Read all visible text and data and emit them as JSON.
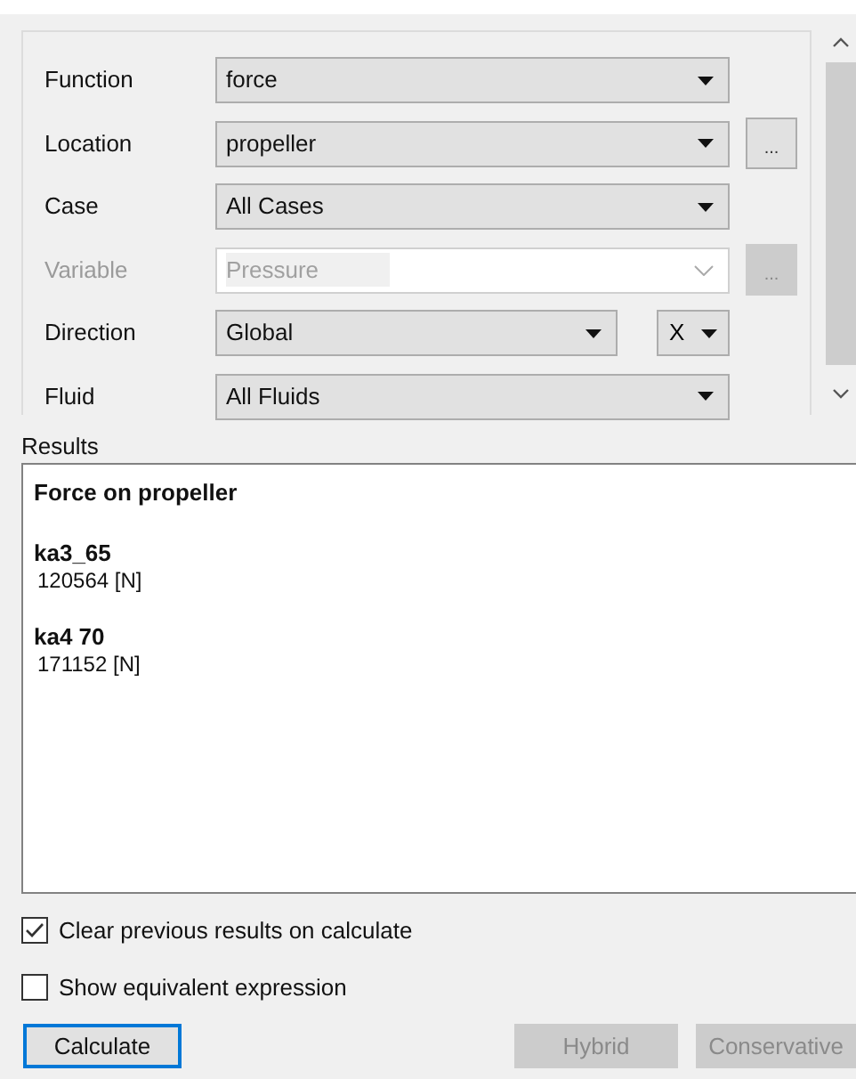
{
  "form": {
    "rows": [
      {
        "label": "Function",
        "value": "force",
        "disabled": false
      },
      {
        "label": "Location",
        "value": "propeller",
        "disabled": false,
        "browse": {
          "label": "...",
          "disabled": false
        }
      },
      {
        "label": "Case",
        "value": "All Cases",
        "disabled": false
      },
      {
        "label": "Variable",
        "value": "Pressure",
        "disabled": true,
        "browse": {
          "label": "...",
          "disabled": true
        }
      },
      {
        "label": "Direction",
        "value": "Global",
        "disabled": false,
        "axis": "X"
      },
      {
        "label": "Fluid",
        "value": "All Fluids",
        "disabled": false
      }
    ]
  },
  "results": {
    "label": "Results",
    "title": "Force on propeller",
    "entries": [
      {
        "name": "ka3_65",
        "value": "120564 [N]"
      },
      {
        "name": "ka4 70",
        "value": "171152 [N]"
      }
    ]
  },
  "options": [
    {
      "label": "Clear previous results on calculate",
      "checked": true
    },
    {
      "label": "Show equivalent expression",
      "checked": false
    }
  ],
  "buttons": [
    {
      "label": "Calculate",
      "disabled": false,
      "focused": true
    },
    {
      "label": "Hybrid",
      "disabled": true,
      "focused": false
    },
    {
      "label": "Conservative",
      "disabled": true,
      "focused": false
    }
  ]
}
